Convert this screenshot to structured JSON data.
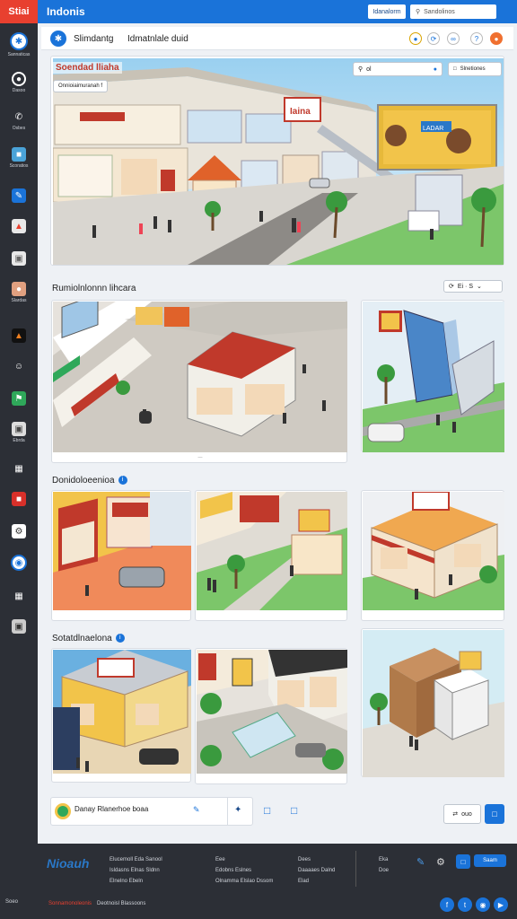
{
  "topbar": {
    "logo": "Stiai",
    "title": "Indonis",
    "button_label": "Idanalorm",
    "search_placeholder": "Sandolinos"
  },
  "sidebar": {
    "items": [
      {
        "icon": "compass-icon",
        "label": "Sannaticas"
      },
      {
        "icon": "target-icon",
        "label": "Dasoo"
      },
      {
        "icon": "shield-icon",
        "label": "Osbes"
      },
      {
        "icon": "building-icon",
        "label": "Scoratios"
      },
      {
        "icon": "pencil-icon",
        "label": ""
      },
      {
        "icon": "chart-icon",
        "label": ""
      },
      {
        "icon": "box-icon",
        "label": ""
      },
      {
        "icon": "paint-icon",
        "label": "Slardas"
      },
      {
        "icon": "flame-icon",
        "label": ""
      },
      {
        "icon": "user-icon",
        "label": ""
      },
      {
        "icon": "flag-icon",
        "label": ""
      },
      {
        "icon": "cube-icon",
        "label": "Ebrda"
      },
      {
        "icon": "puzzle-icon",
        "label": ""
      },
      {
        "icon": "store-icon",
        "label": ""
      },
      {
        "icon": "settings-icon",
        "label": ""
      },
      {
        "icon": "fish-icon",
        "label": ""
      },
      {
        "icon": "grid-icon",
        "label": ""
      },
      {
        "icon": "save-icon",
        "label": ""
      }
    ],
    "foot_label": "Soeo"
  },
  "header": {
    "tab1": "Slimdantg",
    "tab2": "Idmatnlale duid"
  },
  "hero": {
    "title": "Soendad lliaha",
    "badge": "Onnioiaimuranah f",
    "search_label": "ol",
    "button_label": "Slnetiones",
    "billboard": "LADAR"
  },
  "section1": {
    "title": "Rumiolnlonnn lihcara",
    "chip": "Ei · S"
  },
  "section2": {
    "title": "Donidoloeenioa"
  },
  "section3": {
    "title": "Sotatdlnaelona"
  },
  "comment": {
    "text": "Danay Rlanerhoe boaa",
    "next_label": "ouo"
  },
  "footer": {
    "brand": "Nioauh",
    "col1": [
      "Elucemoll Eda  Sanool",
      "Isldasns Elnas Sldnn",
      "Elnelno Ebeln"
    ],
    "col2": [
      "Eee",
      "Edobns Eslnes",
      "Olnamma Elslao Dssom"
    ],
    "col3": [
      "Dees",
      "Daaaaes Dalnd",
      "Elad"
    ],
    "col4": [
      "Eka",
      "Doe"
    ],
    "button_label": "Saam",
    "bottom": [
      "Soeo",
      "Sonnamonoleonis",
      "Deotnoisl Blassoons"
    ]
  }
}
